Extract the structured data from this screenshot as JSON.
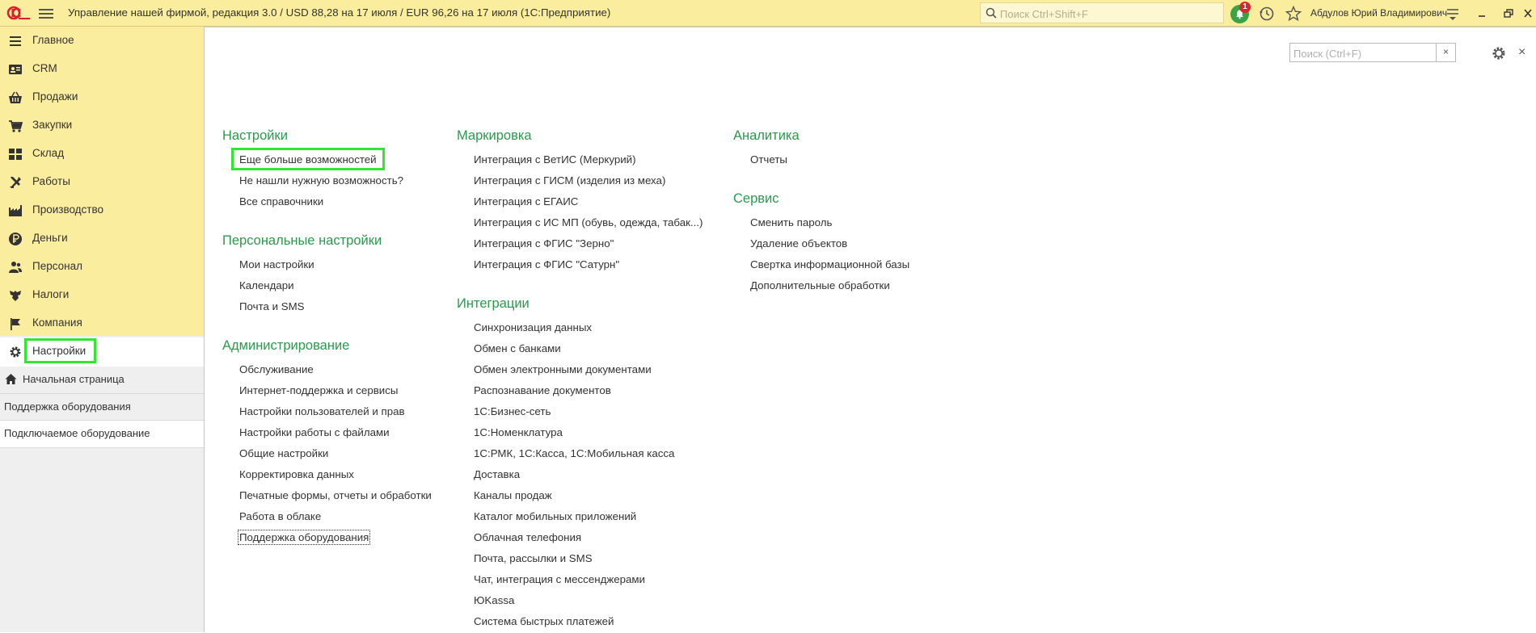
{
  "titlebar": {
    "app_title": "Управление нашей фирмой, редакция 3.0 / USD 88,28 на 17 июля / EUR 96,26 на 17 июля  (1С:Предприятие)",
    "search_placeholder": "Поиск Ctrl+Shift+F",
    "notification_count": "1",
    "user_name": "Абдулов Юрий Владимирович"
  },
  "sidebar": {
    "sections": [
      {
        "label": "Главное",
        "icon": "menu-lines-icon"
      },
      {
        "label": "CRM",
        "icon": "contact-card-icon"
      },
      {
        "label": "Продажи",
        "icon": "shopping-basket-icon"
      },
      {
        "label": "Закупки",
        "icon": "cart-icon"
      },
      {
        "label": "Склад",
        "icon": "warehouse-grid-icon"
      },
      {
        "label": "Работы",
        "icon": "tools-icon"
      },
      {
        "label": "Производство",
        "icon": "factory-icon"
      },
      {
        "label": "Деньги",
        "icon": "ruble-coin-icon"
      },
      {
        "label": "Персонал",
        "icon": "people-icon"
      },
      {
        "label": "Налоги",
        "icon": "eagle-emblem-icon"
      },
      {
        "label": "Компания",
        "icon": "flag-icon"
      },
      {
        "label": "Настройки",
        "icon": "gear-icon"
      }
    ],
    "nav": [
      {
        "label": "Начальная страница",
        "icon": "home-icon"
      },
      {
        "label": "Поддержка оборудования"
      },
      {
        "label": "Подключаемое оборудование"
      }
    ]
  },
  "content": {
    "search_placeholder": "Поиск (Ctrl+F)",
    "clear_symbol": "×",
    "close_symbol": "×",
    "columns": [
      {
        "groups": [
          {
            "title": "Настройки",
            "links": [
              "Еще больше возможностей",
              "Не нашли нужную возможность?",
              "Все справочники"
            ]
          },
          {
            "title": "Персональные настройки",
            "links": [
              "Мои настройки",
              "Календари",
              "Почта и SMS"
            ]
          },
          {
            "title": "Администрирование",
            "links": [
              "Обслуживание",
              "Интернет-поддержка и сервисы",
              "Настройки пользователей и прав",
              "Настройки работы с файлами",
              "Общие настройки",
              "Корректировка данных",
              "Печатные формы, отчеты и обработки",
              "Работа в облаке",
              "Поддержка оборудования"
            ]
          }
        ]
      },
      {
        "groups": [
          {
            "title": "Маркировка",
            "links": [
              "Интеграция с ВетИС (Меркурий)",
              "Интеграция с ГИСМ (изделия из меха)",
              "Интеграция с ЕГАИС",
              "Интеграция с ИС МП (обувь, одежда, табак...)",
              "Интеграция с ФГИС \"Зерно\"",
              "Интеграция с ФГИС \"Сатурн\""
            ]
          },
          {
            "title": "Интеграции",
            "links": [
              "Синхронизация данных",
              "Обмен с банками",
              "Обмен электронными документами",
              "Распознавание документов",
              "1С:Бизнес-сеть",
              "1С:Номенклатура",
              "1С:РМК, 1С:Касса, 1С:Мобильная касса",
              "Доставка",
              "Каналы продаж",
              "Каталог мобильных приложений",
              "Облачная телефония",
              "Почта, рассылки и SMS",
              "Чат, интеграция с мессенджерами",
              "ЮKassa",
              "Система быстрых платежей"
            ]
          }
        ]
      },
      {
        "groups": [
          {
            "title": "Аналитика",
            "links": [
              "Отчеты"
            ]
          },
          {
            "title": "Сервис",
            "links": [
              "Сменить пароль",
              "Удаление объектов",
              "Свертка информационной базы",
              "Дополнительные обработки"
            ]
          }
        ]
      }
    ]
  },
  "colors": {
    "panel_yellow": "#fbed9e",
    "group_title_green": "#2a9a4d",
    "highlight_green": "#32e632",
    "notification_green": "#3aa346",
    "badge_red": "#e0242b"
  }
}
